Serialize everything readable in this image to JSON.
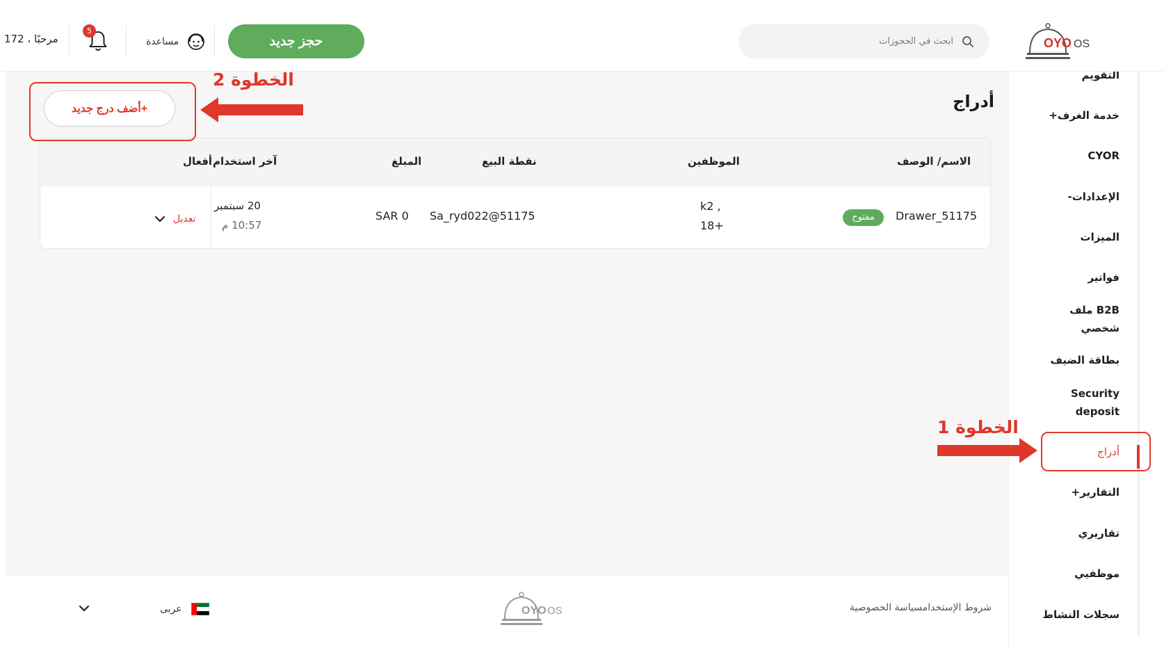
{
  "header": {
    "greeting": "مرحبًا ، 172",
    "notification_count": "5",
    "help_label": "مساعدة",
    "new_booking_label": "حجز جديد",
    "search_placeholder": "ابحث في الحجوزات",
    "logo_text": "OYO OS"
  },
  "sidebar": {
    "items": [
      {
        "label": "التقويم",
        "active": false
      },
      {
        "label": "خدمة الغرف+",
        "active": false
      },
      {
        "label": "CYOR",
        "active": false
      },
      {
        "label": "الإعدادات-",
        "active": false
      },
      {
        "label": "الميزات",
        "active": false
      },
      {
        "label": "فواتير",
        "active": false
      },
      {
        "label": "B2B ملف شخصي",
        "active": false
      },
      {
        "label": "بطاقة الضيف",
        "active": false
      },
      {
        "label": "Security deposit",
        "active": false
      },
      {
        "label": "أدراج",
        "active": true
      },
      {
        "label": "التقارير+",
        "active": false
      },
      {
        "label": "تقاريري",
        "active": false
      },
      {
        "label": "موظفيي",
        "active": false
      },
      {
        "label": "سجلات النشاط",
        "active": false
      }
    ]
  },
  "main": {
    "title": "أدراج",
    "add_button_label": "+أضف درج جديد",
    "table": {
      "headers": {
        "name_desc": "الاسم/ الوصف",
        "staff": "الموظفين",
        "pos": "نقطة البيع",
        "amount": "المبلغ",
        "last_used": "آخر استخدام",
        "actions": "أفعال"
      },
      "rows": [
        {
          "name": "Drawer_51175",
          "status": "مفتوح",
          "staff_line1": "k2 ,",
          "staff_line2": "18+",
          "pos": "Sa_ryd022@51175",
          "amount": "SAR 0",
          "last_used_date": "20 سبتمبر",
          "last_used_time": "10:57 م",
          "action_label": "تعديل"
        }
      ]
    }
  },
  "footer": {
    "links": "شروط الإستخدامسياسة الخصوصية",
    "language": "عربى"
  },
  "annotations": {
    "step1": "الخطوة 1",
    "step2": "الخطوة 2"
  },
  "colors": {
    "accent_red": "#e0372b",
    "brand_green": "#5fac5c",
    "oyo_red": "#d32f2f"
  }
}
